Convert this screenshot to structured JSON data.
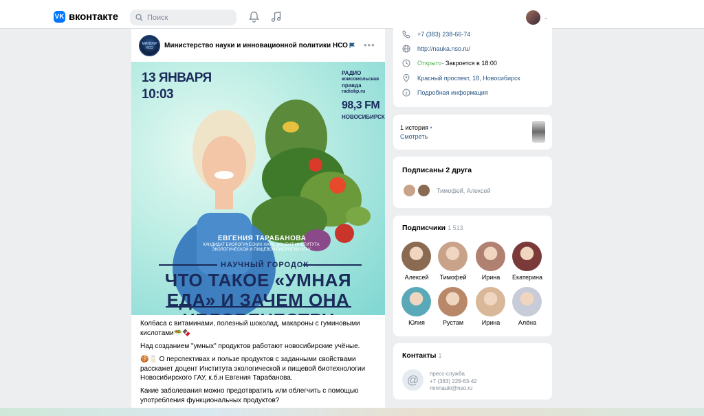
{
  "header": {
    "logo_mark": "VK",
    "logo_text": "вконтакте",
    "search_placeholder": "Поиск"
  },
  "post": {
    "author": "Министерство науки и инновационной политики НСО",
    "avatar_text": "МИНОБР НСО",
    "more": "•••",
    "banner": {
      "date_line1": "13 ЯНВАРЯ",
      "date_line2": "10:03",
      "radio_line1": "РАДИО",
      "radio_line2": "комсомольская",
      "radio_line3": "правда",
      "radio_site": "radiokp.ru",
      "frequency": "98,3 FM",
      "city": "НОВОСИБИРСК",
      "person_name": "ЕВГЕНИЯ ТАРАБАНОВА",
      "person_title": "КАНДИДАТ БИОЛОГИЧЕСКИХ НАУК, ДОЦЕНТ ИНСТИТУТА ЭКОЛОГИЧЕСКОЙ И ПИЩЕВОЙ БИОЛОГИИ НГАУ",
      "show_name": "НАУЧНЫЙ ГОРОДОК",
      "headline": "ЧТО ТАКОЕ «УМНАЯ ЕДА» И ЗАЧЕМ ОНА ЧЕЛОВЕЧЕСТВУ"
    },
    "paragraphs": [
      "Колбаса с витаминами, полезный шоколад, макароны с гуминовыми кислотами🥗🍫",
      "Над созданием \"умных\" продуктов работают новосибирские учёные.",
      "🍪🥛 О перспективах и пользе продуктов с заданными свойствами расскажет доцент Института экологической и пищевой биотехнологии Новосибирского ГАУ, к.б.н Евгения Тарабанова.",
      "Какие заболевания можно предотвратить или облегчить с помощью употребления функциональных продуктов?"
    ]
  },
  "info": {
    "phone": "+7 (383) 238-66-74",
    "site": "http://nauka.nso.ru/",
    "status_open": "Открыто",
    "status_rest": " · Закроется в 18:00",
    "address": "Красный проспект, 18, Новосибирск",
    "more_info": "Подробная информация"
  },
  "stories": {
    "count_label": "1 история",
    "watch": "Смотреть"
  },
  "friends": {
    "title": "Подписаны 2 друга",
    "names": "Тимофей, Алексей"
  },
  "subscribers": {
    "title": "Подписчики",
    "count": "1 513",
    "people": [
      {
        "name": "Алексей",
        "color": "#8a6a50"
      },
      {
        "name": "Тимофей",
        "color": "#c9a28a"
      },
      {
        "name": "Ирина",
        "color": "#b08070"
      },
      {
        "name": "Екатерина",
        "color": "#7a3a3a"
      },
      {
        "name": "Юлия",
        "color": "#5aa9b8"
      },
      {
        "name": "Рустам",
        "color": "#b88868"
      },
      {
        "name": "Ирина",
        "color": "#d8b898"
      },
      {
        "name": "Алёна",
        "color": "#c8ccd8"
      }
    ]
  },
  "contacts": {
    "title": "Контакты",
    "count": "1",
    "role": "пресс-служба",
    "phone": "+7 (383) 228-63-42",
    "email": "minnauki@nso.ru"
  }
}
